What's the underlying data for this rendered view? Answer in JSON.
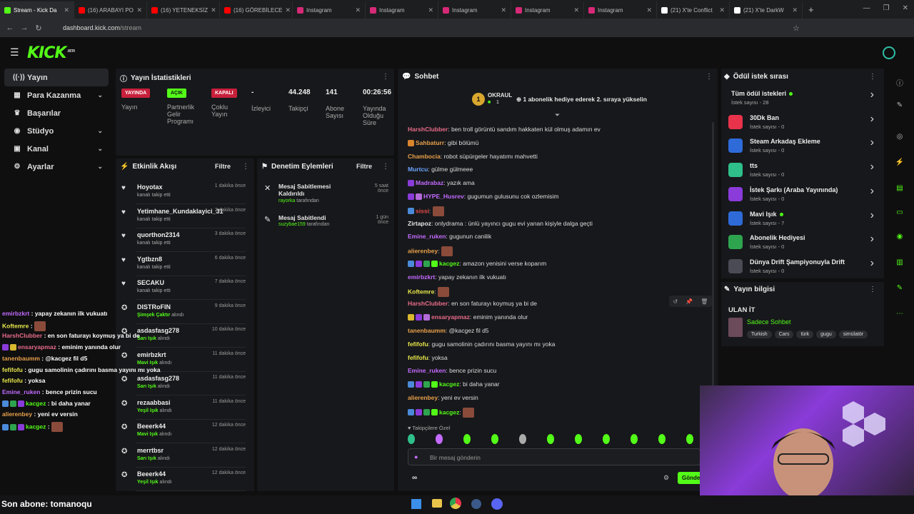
{
  "browser": {
    "tabs": [
      {
        "label": "Stream - Kick Da",
        "color": "#53fc18",
        "active": true
      },
      {
        "label": "(16) ARABAYI PO",
        "color": "#ff0000"
      },
      {
        "label": "(16) YETENEKSİZ",
        "color": "#ff0000"
      },
      {
        "label": "(16) GÖREBİLECE",
        "color": "#ff0000"
      },
      {
        "label": "Instagram",
        "color": "#d62976"
      },
      {
        "label": "Instagram",
        "color": "#d62976"
      },
      {
        "label": "Instagram",
        "color": "#d62976"
      },
      {
        "label": "Instagram",
        "color": "#d62976"
      },
      {
        "label": "Instagram",
        "color": "#d62976"
      },
      {
        "label": "(21) X'te Conflict",
        "color": "#ffffff"
      },
      {
        "label": "(21) X'te DarkW",
        "color": "#ffffff"
      }
    ],
    "url_host": "dashboard.kick.com",
    "url_path": "/stream"
  },
  "brand": {
    "logo": "KICK",
    "beta": "BETA",
    "accent": "#53fc18"
  },
  "nav": {
    "items": [
      {
        "label": "Yayın",
        "icon": "broadcast-icon",
        "glyph": "((·))"
      },
      {
        "label": "Para Kazanma",
        "icon": "money-icon",
        "glyph": "▦"
      },
      {
        "label": "Başarılar",
        "icon": "trophy-icon",
        "glyph": "♛"
      },
      {
        "label": "Stüdyo",
        "icon": "studio-icon",
        "glyph": "◉"
      },
      {
        "label": "Kanal",
        "icon": "channel-icon",
        "glyph": "▣"
      },
      {
        "label": "Ayarlar",
        "icon": "settings-icon",
        "glyph": "⚙"
      }
    ]
  },
  "stats": {
    "title": "Yayın İstatistikleri",
    "live_badge": "YAYINDA",
    "live_label": "Yayın",
    "partner_badge": "AÇIK",
    "partner_label": "Partnerlik Gelir Programı",
    "multi_badge": "KAPALI",
    "multi_label": "Çoklu Yayın",
    "viewers_value": "-",
    "viewers_label": "İzleyici",
    "followers_value": "44.248",
    "followers_label": "Takipçi",
    "subs_value": "141",
    "subs_label": "Abone Sayısı",
    "uptime_value": "00:26:56",
    "uptime_label": "Yayında Olduğu Süre"
  },
  "activity": {
    "title": "Etkinlik Akışı",
    "filter": "Filtre",
    "rows": [
      {
        "name": "Hoyotax",
        "sub": "kanalı takip etti",
        "time": "1 dakika önce",
        "icon": "♥",
        "sub_color": "#aaaaaa"
      },
      {
        "name": "Yetimhane_Kundaklayici_31",
        "sub": "kanalı takip etti",
        "time": "2 dakika önce",
        "icon": "♥",
        "sub_color": "#aaaaaa"
      },
      {
        "name": "quorthon2314",
        "sub": "kanalı takip etti",
        "time": "3 dakika önce",
        "icon": "♥",
        "sub_color": "#aaaaaa"
      },
      {
        "name": "Ygtbzn8",
        "sub": "kanalı takip etti",
        "time": "6 dakika önce",
        "icon": "♥",
        "sub_color": "#aaaaaa"
      },
      {
        "name": "SECAKU",
        "sub": "kanalı takip etti",
        "time": "7 dakika önce",
        "icon": "♥",
        "sub_color": "#aaaaaa"
      },
      {
        "name": "DISTRoFIN",
        "sub_em": "Şimşek Çaktır",
        "sub": "alındı",
        "time": "9 dakika önce",
        "icon": "✪",
        "sub_color": "#53fc18"
      },
      {
        "name": "asdasfasg278",
        "sub_em": "Sarı Işık",
        "sub": "alındı",
        "time": "10 dakika önce",
        "icon": "✪",
        "sub_color": "#53fc18"
      },
      {
        "name": "emirbzkrt",
        "sub_em": "Mavi Işık",
        "sub": "alındı",
        "time": "11 dakika önce",
        "icon": "✪",
        "sub_color": "#53fc18"
      },
      {
        "name": "asdasfasg278",
        "sub_em": "Sarı Işık",
        "sub": "alındı",
        "time": "11 dakika önce",
        "icon": "✪",
        "sub_color": "#53fc18"
      },
      {
        "name": "rezaabbasi",
        "sub_em": "Yeşil Işık",
        "sub": "alındı",
        "time": "11 dakika önce",
        "icon": "✪",
        "sub_color": "#53fc18"
      },
      {
        "name": "Beeerk44",
        "sub_em": "Mavi Işık",
        "sub": "alındı",
        "time": "12 dakika önce",
        "icon": "✪",
        "sub_color": "#53fc18"
      },
      {
        "name": "merrtbsr",
        "sub_em": "Sarı Işık",
        "sub": "alındı",
        "time": "12 dakika önce",
        "icon": "✪",
        "sub_color": "#53fc18"
      },
      {
        "name": "Beeerk44",
        "sub_em": "Yeşil Işık",
        "sub": "alındı",
        "time": "12 dakika önce",
        "icon": "✪",
        "sub_color": "#53fc18"
      }
    ]
  },
  "moderation": {
    "title": "Denetim Eylemleri",
    "filter": "Filtre",
    "rows": [
      {
        "action": "Mesaj Sabitlemesi Kaldırıldı",
        "by_user": "rayorka",
        "by_suffix": "tarafından",
        "time": "5 saat önce",
        "icon": "✕"
      },
      {
        "action": "Mesaj Sabitlendi",
        "by_user": "suzybae159",
        "by_suffix": "tarafından",
        "time": "1 gün önce",
        "icon": "✎"
      }
    ]
  },
  "chat": {
    "title": "Sohbet",
    "top_user": "OKRAUL",
    "top_user_count": "1",
    "top_rank": "1",
    "pinned_text": "1 abonelik hediye ederek 2. sıraya yükselin",
    "messages": [
      {
        "user": "HarshClubber",
        "color": "#e86b8a",
        "text": "ben troll görüntü sandım hakkaten kül olmuş adamın ev"
      },
      {
        "user": "Sahbaturr",
        "color": "#e8a04b",
        "text": "gibi bölümü",
        "badges": [
          "#d9852e"
        ]
      },
      {
        "user": "Chambocia",
        "color": "#e8a04b",
        "text": "robot süpürgeler hayatımı mahvetti"
      },
      {
        "user": "Murtcu",
        "color": "#6ba3ff",
        "text": "gülme gülmeee"
      },
      {
        "user": "Madrabaz",
        "color": "#c36bff",
        "text": "yazık ama",
        "badges": [
          "#8a3bd9"
        ]
      },
      {
        "user": "HYPE_Husrev",
        "color": "#c36bff",
        "text": "gugumun gulusunu cok ozlemisim",
        "badges": [
          "#8a3bd9",
          "#b36bd9"
        ]
      },
      {
        "user": "sissi",
        "color": "#e84b4b",
        "text": "",
        "emote": true,
        "badges": [
          "#4b8ad9"
        ]
      },
      {
        "user": "Zirtapoz",
        "color": "#e8e8e8",
        "text": "onlydrama : ünlü yayıncı gugu evi yanan kişiyle dalga geçti"
      },
      {
        "user": "Emine_ruken",
        "color": "#c36bff",
        "text": "gugunun canilik"
      },
      {
        "user": "alierenbey",
        "color": "#e8a04b",
        "text": "",
        "emote": true
      },
      {
        "user": "kacgez",
        "color": "#53fc18",
        "text": "amazon yenisini verse koparım",
        "badges": [
          "#4b8ad9",
          "#8a3bd9",
          "#2ea44f",
          "#53fc18"
        ]
      },
      {
        "user": "emirbzkrt",
        "color": "#c36bff",
        "text": "yapay zekanın ilk vukuatı"
      },
      {
        "user": "Koftemre",
        "color": "#e8e84b",
        "text": "",
        "emote": true
      },
      {
        "user": "HarshClubber",
        "color": "#e86b8a",
        "text": "en son faturayı koymuş ya bi de"
      },
      {
        "user": "ensaryapmaz",
        "color": "#e86b8a",
        "text": "eminim yanında olur",
        "badges": [
          "#d9b82e",
          "#8a3bd9",
          "#b36bd9"
        ]
      },
      {
        "user": "tanenbaumm",
        "color": "#e8a04b",
        "text": "@kacgez fil d5"
      },
      {
        "user": "fefifofu",
        "color": "#e8e84b",
        "text": "gugu samolinin çadırını basma yayını mı yoka"
      },
      {
        "user": "fefifofu",
        "color": "#e8e84b",
        "text": "yoksa"
      },
      {
        "user": "Emine_ruken",
        "color": "#c36bff",
        "text": "bence prizin sucu"
      },
      {
        "user": "kacgez",
        "color": "#53fc18",
        "text": "bi daha yanar",
        "badges": [
          "#4b8ad9",
          "#8a3bd9",
          "#2ea44f",
          "#53fc18"
        ]
      },
      {
        "user": "alierenbey",
        "color": "#e8a04b",
        "text": "yeni ev versin"
      },
      {
        "user": "kacgez",
        "color": "#53fc18",
        "text": "",
        "emote": true,
        "badges": [
          "#4b8ad9",
          "#8a3bd9",
          "#2ea44f",
          "#53fc18"
        ]
      }
    ],
    "emote_section": "Takipçilere Özel",
    "input_placeholder": "Bir mesaj gönderin",
    "send_label": "Gönde",
    "infinity": "∞"
  },
  "rewards": {
    "title": "Ödül istek sırası",
    "items": [
      {
        "name": "Tüm ödül istekleri",
        "count": "İstek sayısı - 28",
        "color": "",
        "dot": true
      },
      {
        "name": "30Dk Ban",
        "count": "İstek sayısı - 0",
        "color": "#e8334b"
      },
      {
        "name": "Steam Arkadaş Ekleme",
        "count": "İstek sayısı - 0",
        "color": "#2e6bd9"
      },
      {
        "name": "tts",
        "count": "İstek sayısı - 0",
        "color": "#2ebf8a"
      },
      {
        "name": "İstek Şarkı (Araba Yayınında)",
        "count": "İstek sayısı - 0",
        "color": "#8a3bd9"
      },
      {
        "name": "Mavi Işık",
        "count": "İstek sayısı - 7",
        "color": "#2e6bd9",
        "dot": true
      },
      {
        "name": "Abonelik Hediyesi",
        "count": "İstek sayısı - 0",
        "color": "#2ea44f"
      },
      {
        "name": "Dünya Drift Şampiyonuyla Drift",
        "count": "İstek sayısı - 0",
        "color": "#4b4b55"
      }
    ]
  },
  "stream_info": {
    "title": "Yayın bilgisi",
    "stream_title": "ULAN İT",
    "category": "Sadece Sohbet",
    "tags": [
      "Turkish",
      "Cars",
      "türk",
      "gugu",
      "simülatör"
    ]
  },
  "overlay_chat": [
    {
      "user": "emirbzkrt",
      "color": "#c36bff",
      "text": ": yapay zekanın ilk vukuatı"
    },
    {
      "user": "Koftemre",
      "color": "#e8e84b",
      "text": ":",
      "emote": true
    },
    {
      "user": "HarshClubber",
      "color": "#e86b8a",
      "text": ": en son faturayı koymuş ya bi de"
    },
    {
      "user": "ensaryapmaz",
      "color": "#e86b8a",
      "text": ": eminim yanında olur",
      "badges": [
        "#8a3bd9",
        "#d9b82e"
      ]
    },
    {
      "user": "tanenbaumm",
      "color": "#e8a04b",
      "text": ": @kacgez fil d5"
    },
    {
      "user": "fefifofu",
      "color": "#e8e84b",
      "text": ": gugu samolinin çadırını basma yayını mı yoka"
    },
    {
      "user": "fefifofu",
      "color": "#e8e84b",
      "text": ": yoksa"
    },
    {
      "user": "Emine_ruken",
      "color": "#c36bff",
      "text": ": bence prizin sucu"
    },
    {
      "user": "kacgez",
      "color": "#53fc18",
      "text": ": bi daha yanar",
      "badges": [
        "#4b8ad9",
        "#2ea44f",
        "#8a3bd9"
      ]
    },
    {
      "user": "alierenbey",
      "color": "#e8a04b",
      "text": ": yeni ev versin"
    },
    {
      "user": "kacgez",
      "color": "#53fc18",
      "text": ":",
      "emote": true,
      "badges": [
        "#4b8ad9",
        "#2ea44f",
        "#8a3bd9"
      ]
    }
  ],
  "last_sub": "Son abone: tomanoqu"
}
